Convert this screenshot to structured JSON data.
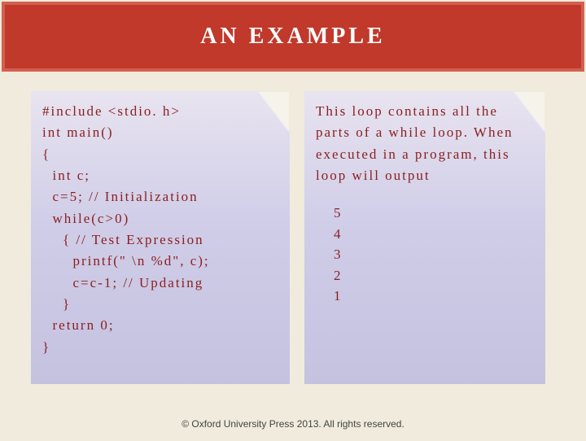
{
  "header": {
    "title": "AN EXAMPLE"
  },
  "left": {
    "code": "#include <stdio. h>\nint main()\n{\n  int c;\n  c=5; // Initialization\n  while(c>0)\n    { // Test Expression\n      printf(\" \\n %d\", c);\n      c=c-1; // Updating\n    }\n  return 0;\n}"
  },
  "right": {
    "description": " This loop contains all the parts of a while loop. When executed in a program, this loop will output",
    "output": [
      "5",
      "4",
      "3",
      "2",
      "1"
    ]
  },
  "footer": {
    "text": "© Oxford University Press 2013. All rights reserved."
  }
}
